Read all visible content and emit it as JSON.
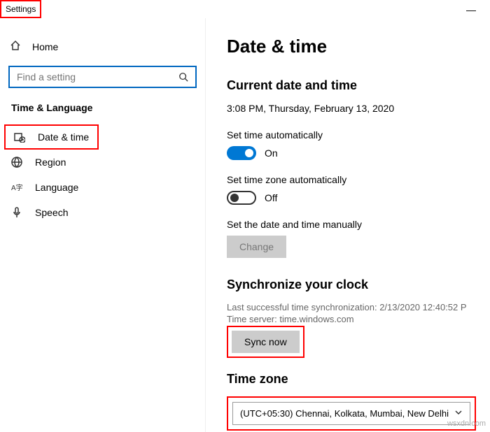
{
  "window": {
    "title": "Settings"
  },
  "sidebar": {
    "home": "Home",
    "search_placeholder": "Find a setting",
    "category": "Time & Language",
    "items": [
      {
        "label": "Date & time"
      },
      {
        "label": "Region"
      },
      {
        "label": "Language"
      },
      {
        "label": "Speech"
      }
    ]
  },
  "main": {
    "title": "Date & time",
    "subtitle": "Current date and time",
    "datetime": "3:08 PM, Thursday, February 13, 2020",
    "auto_time_label": "Set time automatically",
    "auto_time_state": "On",
    "auto_tz_label": "Set time zone automatically",
    "auto_tz_state": "Off",
    "manual_label": "Set the date and time manually",
    "change_btn": "Change",
    "sync_heading": "Synchronize your clock",
    "sync_last": "Last successful time synchronization: 2/13/2020 12:40:52 P",
    "sync_server": "Time server: time.windows.com",
    "sync_btn": "Sync now",
    "tz_heading": "Time zone",
    "tz_value": "(UTC+05:30) Chennai, Kolkata, Mumbai, New Delhi"
  },
  "watermark": "wsxdn.com"
}
